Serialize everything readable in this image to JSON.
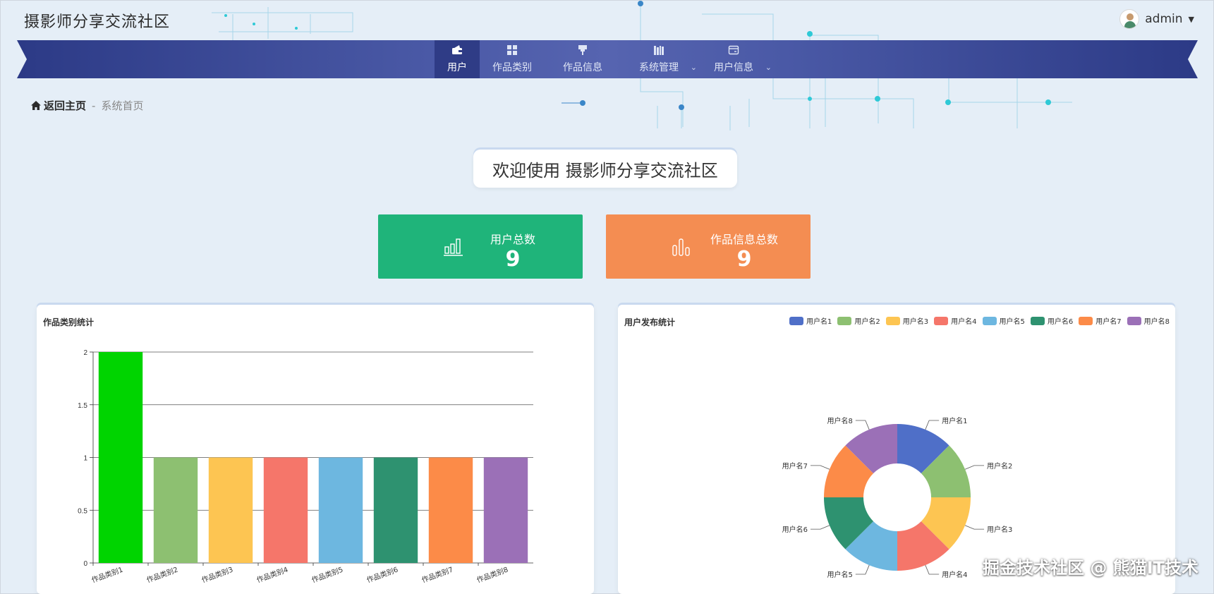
{
  "header": {
    "site_title": "摄影师分享交流社区",
    "username": "admin"
  },
  "nav": {
    "items": [
      {
        "label": "用户",
        "icon": "wallet-icon",
        "active": true,
        "dropdown": false
      },
      {
        "label": "作品类别",
        "icon": "grid-icon",
        "active": false,
        "dropdown": false
      },
      {
        "label": "作品信息",
        "icon": "brush-icon",
        "active": false,
        "dropdown": false
      },
      {
        "label": "系统管理",
        "icon": "books-icon",
        "active": false,
        "dropdown": true
      },
      {
        "label": "用户信息",
        "icon": "card-icon",
        "active": false,
        "dropdown": true
      }
    ]
  },
  "breadcrumb": {
    "home_label": "返回主页",
    "separator": "-",
    "current": "系统首页"
  },
  "welcome": {
    "text": "欢迎使用 摄影师分享交流社区"
  },
  "stats": [
    {
      "label": "用户总数",
      "value": "9",
      "color": "#1fb47a",
      "icon": "bar-chart-icon"
    },
    {
      "label": "作品信息总数",
      "value": "9",
      "color": "#f48d52",
      "icon": "column-chart-icon"
    }
  ],
  "chart_data": [
    {
      "type": "bar",
      "title": "作品类别统计",
      "categories": [
        "作品类别1",
        "作品类别2",
        "作品类别3",
        "作品类别4",
        "作品类别5",
        "作品类别6",
        "作品类别7",
        "作品类别8"
      ],
      "values": [
        2,
        1,
        1,
        1,
        1,
        1,
        1,
        1
      ],
      "colors": [
        "#00d400",
        "#8dc071",
        "#fdc552",
        "#f5766a",
        "#6db7e0",
        "#2e9270",
        "#fc8b48",
        "#9b70b7"
      ],
      "ylim": [
        0,
        2
      ],
      "yticks": [
        "0",
        "0.5",
        "1",
        "1.5",
        "2"
      ],
      "grid": true
    },
    {
      "type": "pie",
      "title": "用户发布统计",
      "labels": [
        "用户名1",
        "用户名2",
        "用户名3",
        "用户名4",
        "用户名5",
        "用户名6",
        "用户名7",
        "用户名8"
      ],
      "values": [
        1,
        1,
        1,
        1,
        1,
        1,
        1,
        1
      ],
      "colors": [
        "#4f6fc8",
        "#8dc071",
        "#fdc552",
        "#f5766a",
        "#6db7e0",
        "#2e9270",
        "#fc8b48",
        "#9b70b7"
      ],
      "donut": true,
      "legend_position": "top-right"
    }
  ],
  "watermark": "掘金技术社区 @ 熊猫IT技术"
}
